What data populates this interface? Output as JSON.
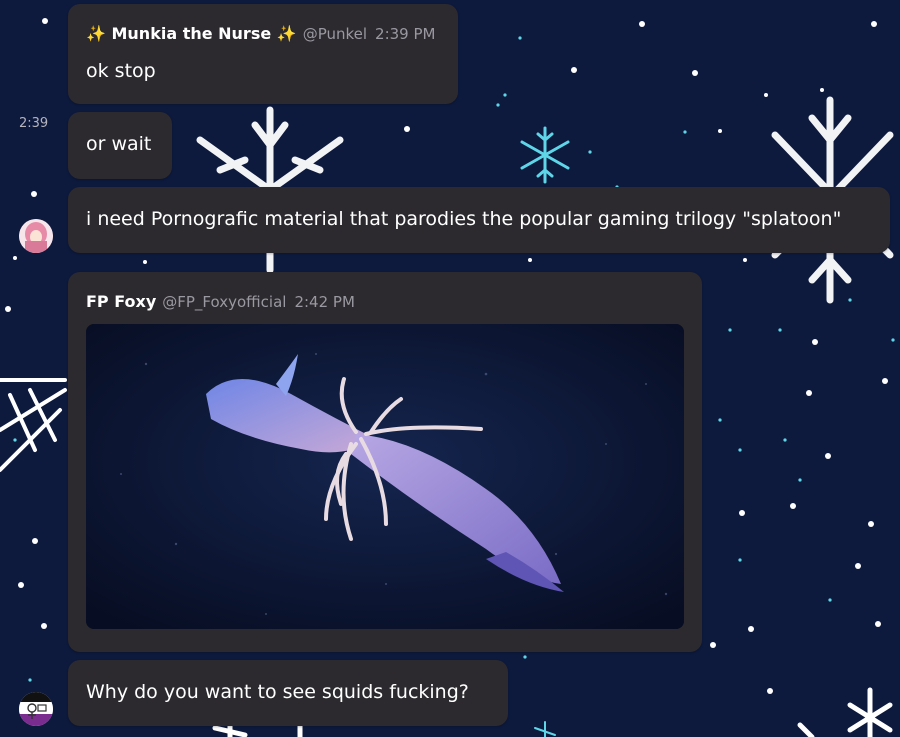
{
  "messages": [
    {
      "author": "✨ Munkia the Nurse ✨",
      "handle": "@Punkel",
      "time": "2:39 PM",
      "text": "ok stop"
    },
    {
      "side_time": "2:39",
      "text": "or wait"
    },
    {
      "text": "i need Pornografic material that parodies the popular gaming trilogy \"splatoon\""
    },
    {
      "author": "FP Foxy",
      "handle": "@FP_Foxyofficial",
      "time": "2:42 PM",
      "image": "squid-photo"
    },
    {
      "text": "Why do you want to see squids fucking?"
    }
  ],
  "colors": {
    "background": "#0d1a3e",
    "bubble": "#2c2a2e",
    "text": "#ffffff",
    "muted": "#9a98a0",
    "snowflake_accent": "#5fd6e8"
  },
  "icons": [
    "snowflake-icon",
    "avatar-pink-hair",
    "avatar-stick-figure"
  ]
}
